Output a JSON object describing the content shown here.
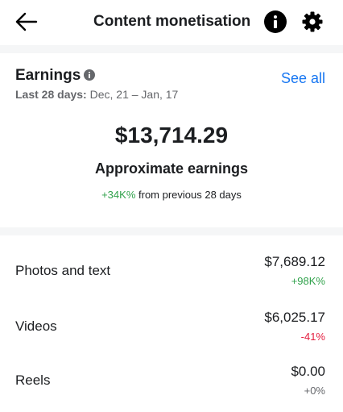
{
  "header": {
    "title": "Content monetisation",
    "back_icon": "arrow-left-icon",
    "info_icon": "info-icon",
    "settings_icon": "gear-icon"
  },
  "earnings": {
    "title": "Earnings",
    "see_all": "See all",
    "date_label": "Last 28 days:",
    "date_range": " Dec, 21 – Jan, 17",
    "amount": "$13,714.29",
    "amount_label": "Approximate earnings",
    "change": "+34K%",
    "change_suffix": " from previous 28 days"
  },
  "breakdown": [
    {
      "label": "Photos and text",
      "value": "$7,689.12",
      "change": "+98K%"
    },
    {
      "label": "Videos",
      "value": "$6,025.17",
      "change": "-41%"
    },
    {
      "label": "Reels",
      "value": "$0.00",
      "change": "+0%"
    }
  ],
  "colors": {
    "accent": "#1877f2",
    "positive": "#31a24c",
    "negative": "#e41e3f",
    "muted": "#65676b"
  }
}
